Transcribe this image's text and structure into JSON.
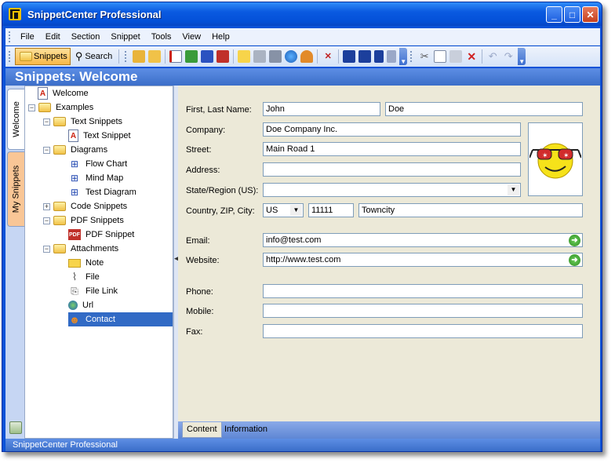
{
  "window": {
    "title": "SnippetCenter Professional",
    "min": "_",
    "max": "□",
    "close": "✕"
  },
  "menu": [
    "File",
    "Edit",
    "Section",
    "Snippet",
    "Tools",
    "View",
    "Help"
  ],
  "toolbar": {
    "snippets": "Snippets",
    "search": "Search"
  },
  "header": {
    "title": "Snippets: Welcome"
  },
  "vtabs": {
    "welcome": "Welcome",
    "my": "My Snippets"
  },
  "tree": {
    "welcome": "Welcome",
    "examples": "Examples",
    "text_snippets": "Text Snippets",
    "text_snippet": "Text Snippet",
    "diagrams": "Diagrams",
    "flow_chart": "Flow Chart",
    "mind_map": "Mind Map",
    "test_diagram": "Test Diagram",
    "code_snippets": "Code Snippets",
    "pdf_snippets": "PDF Snippets",
    "pdf_snippet": "PDF Snippet",
    "pdf_icon": "PDF",
    "attachments": "Attachments",
    "note": "Note",
    "file": "File",
    "file_link": "File Link",
    "url": "Url",
    "contact": "Contact"
  },
  "form": {
    "labels": {
      "name": "First, Last Name:",
      "company": "Company:",
      "street": "Street:",
      "address": "Address:",
      "state": "State/Region (US):",
      "country": "Country, ZIP, City:",
      "email": "Email:",
      "website": "Website:",
      "phone": "Phone:",
      "mobile": "Mobile:",
      "fax": "Fax:"
    },
    "values": {
      "first": "John",
      "last": "Doe",
      "company": "Doe Company Inc.",
      "street": "Main Road 1",
      "address": "",
      "state": "",
      "country": "US",
      "zip": "11111",
      "city": "Towncity",
      "email": "info@test.com",
      "website": "http://www.test.com",
      "phone": "",
      "mobile": "",
      "fax": ""
    }
  },
  "bottom_tabs": {
    "content": "Content",
    "information": "Information"
  },
  "status": "SnippetCenter Professional"
}
